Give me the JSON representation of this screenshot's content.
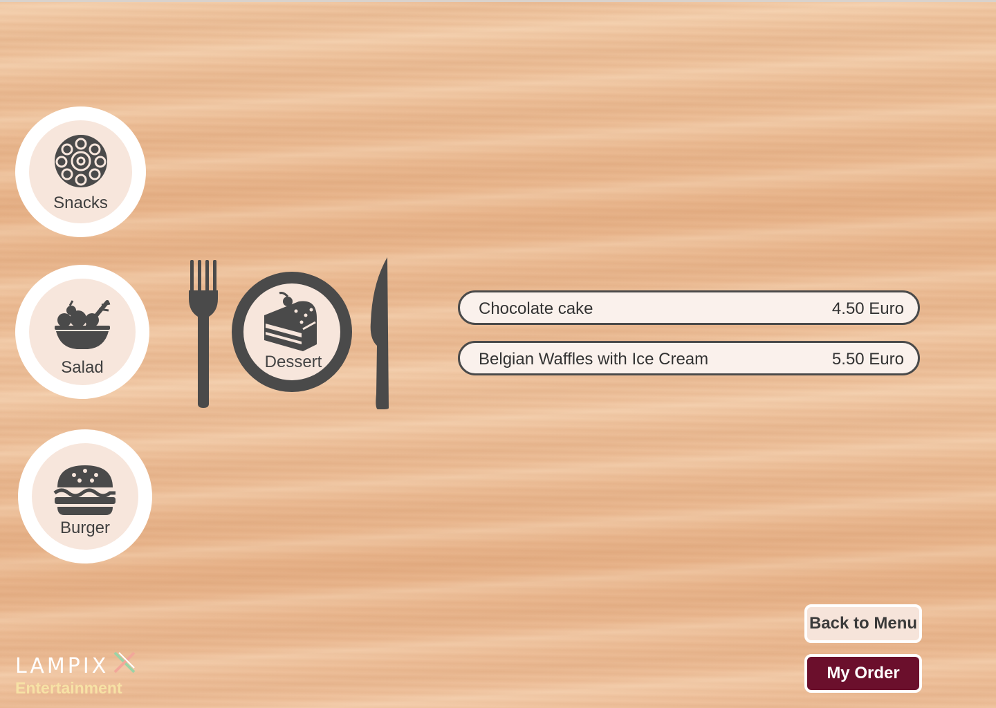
{
  "categories": [
    {
      "label": "Snacks",
      "icon": "donuts-icon"
    },
    {
      "label": "Salad",
      "icon": "salad-bowl-icon"
    },
    {
      "label": "Burger",
      "icon": "burger-icon"
    }
  ],
  "selected_category": {
    "label": "Dessert",
    "icon": "cake-slice-icon"
  },
  "menu_items": [
    {
      "name": "Chocolate cake",
      "price": "4.50 Euro"
    },
    {
      "name": "Belgian Waffles with Ice Cream",
      "price": "5.50 Euro"
    }
  ],
  "buttons": {
    "back": "Back to Menu",
    "order": "My Order"
  },
  "logo": {
    "brand": "LAMPIX",
    "subtitle": "Entertainment"
  },
  "colors": {
    "order_button": "#6b0f2c",
    "icon_dark": "#4a4a4a",
    "category_fill": "#f7e6dc",
    "logo_subtitle": "#f7e2a5"
  }
}
